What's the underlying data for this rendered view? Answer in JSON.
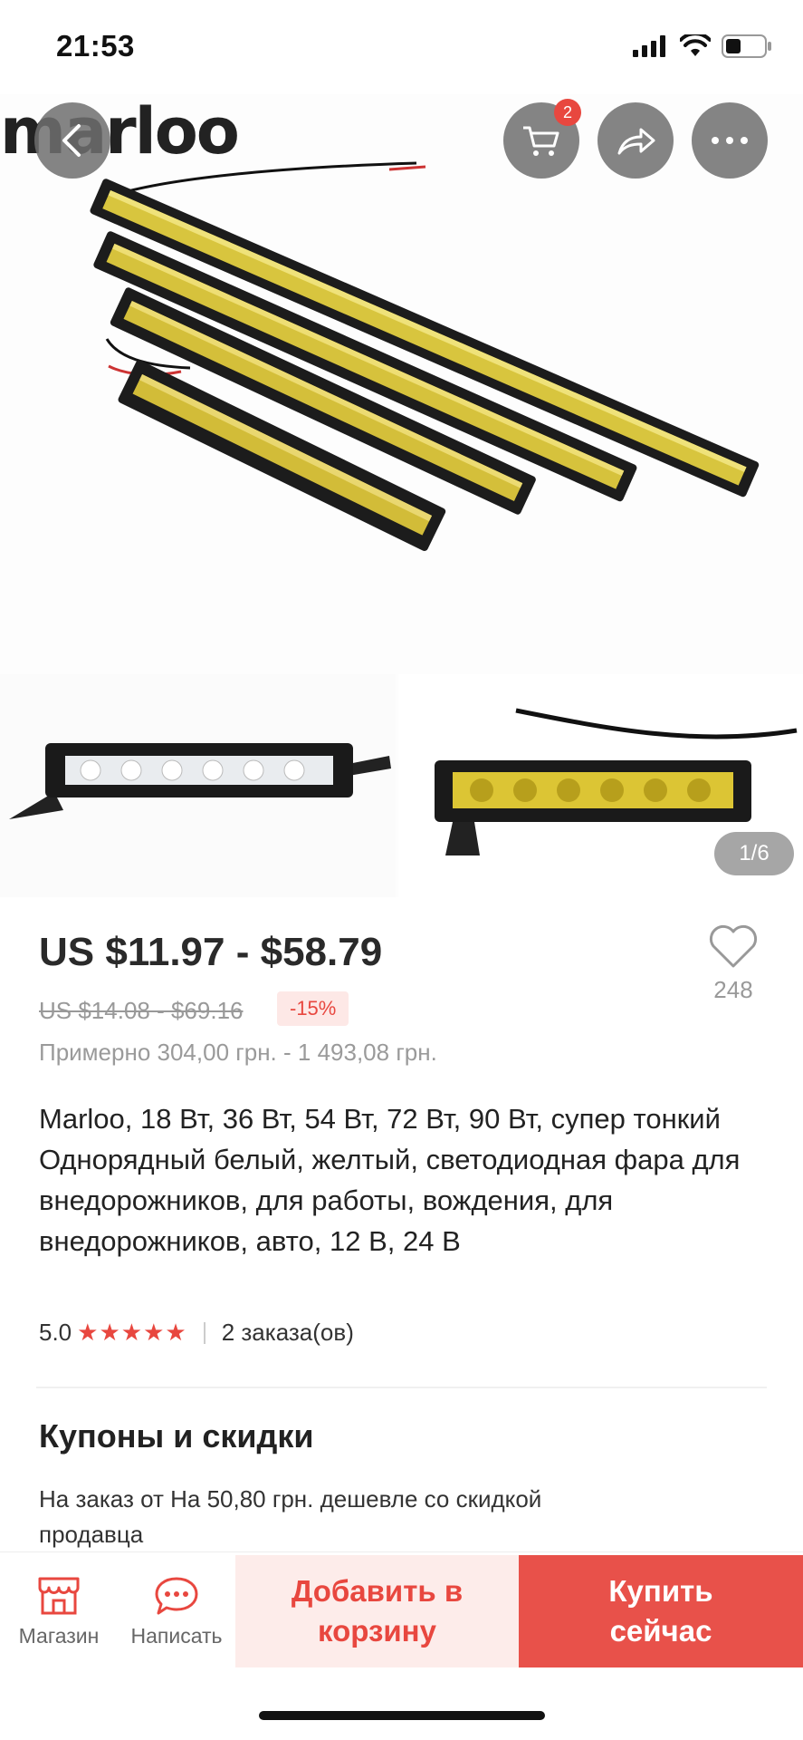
{
  "status": {
    "time": "21:53"
  },
  "header": {
    "logo_text": "marloo",
    "cart_badge": "2"
  },
  "gallery": {
    "pager": "1/6"
  },
  "product": {
    "price": "US $11.97 - $58.79",
    "original_price": "US $14.08 - $69.16",
    "discount": "-15%",
    "approx_price": "Примерно 304,00 грн. - 1 493,08 грн.",
    "favorites_count": "248",
    "title": "Marloo, 18 Вт, 36 Вт, 54 Вт, 72 Вт, 90 Вт, супер тонкий Однорядный белый, желтый, светодиодная фара для внедорожников, для работы, вождения, для внедорожников, авто, 12 В, 24 В",
    "rating": "5.0",
    "stars": "★★★★★",
    "orders": "2 заказа(ов)"
  },
  "coupons": {
    "title": "Купоны и скидки",
    "text": "На заказ от На 50,80 грн. дешевле со скидкой продавца"
  },
  "bottom_bar": {
    "store_label": "Магазин",
    "message_label": "Написать",
    "add_to_cart": "Добавить в корзину",
    "buy_now": "Купить сейчас"
  },
  "colors": {
    "accent": "#e8473f",
    "light_accent": "#fdecea",
    "bar_yellow": "#e6d24a",
    "bar_body": "#1c1c1c"
  },
  "icons": [
    "back-arrow-icon",
    "cart-icon",
    "share-icon",
    "more-icon",
    "heart-icon",
    "store-icon",
    "chat-icon",
    "signal-icon",
    "wifi-icon",
    "battery-icon",
    "globe-icon"
  ]
}
